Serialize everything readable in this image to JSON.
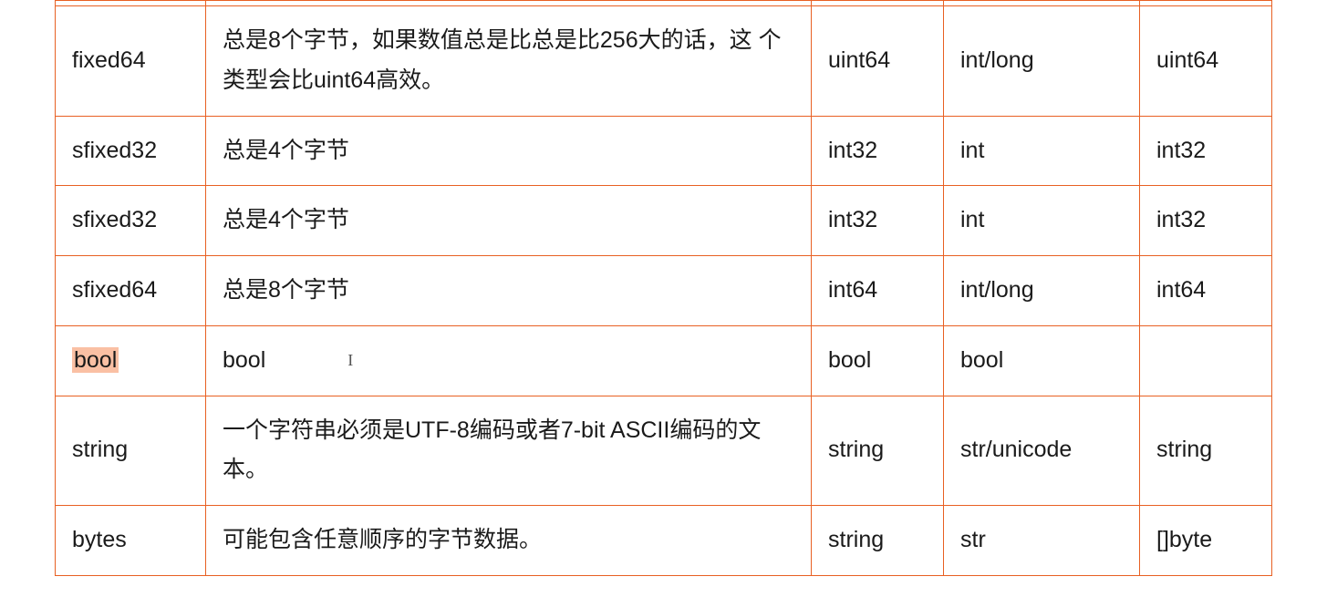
{
  "rows": [
    {
      "c1": "fixed64",
      "c2": "总是8个字节，如果数值总是比总是比256大的话，这 个类型会比uint64高效。",
      "c3": "uint64",
      "c4": "int/long",
      "c5": "uint64"
    },
    {
      "c1": "sfixed32",
      "c2": "总是4个字节",
      "c3": "int32",
      "c4": "int",
      "c5": "int32"
    },
    {
      "c1": "sfixed32",
      "c2": "总是4个字节",
      "c3": "int32",
      "c4": "int",
      "c5": "int32"
    },
    {
      "c1": "sfixed64",
      "c2": "总是8个字节",
      "c3": "int64",
      "c4": "int/long",
      "c5": "int64"
    },
    {
      "c1": "bool",
      "c2": "bool",
      "c3": "bool",
      "c4": "bool",
      "c5": ""
    },
    {
      "c1": "string",
      "c2": "一个字符串必须是UTF-8编码或者7-bit ASCII编码的文 本。",
      "c3": "string",
      "c4": "str/unicode",
      "c5": "string"
    },
    {
      "c1": "bytes",
      "c2": "可能包含任意顺序的字节数据。",
      "c3": "string",
      "c4": "str",
      "c5": "[]byte"
    }
  ],
  "cursor_glyph": "I"
}
